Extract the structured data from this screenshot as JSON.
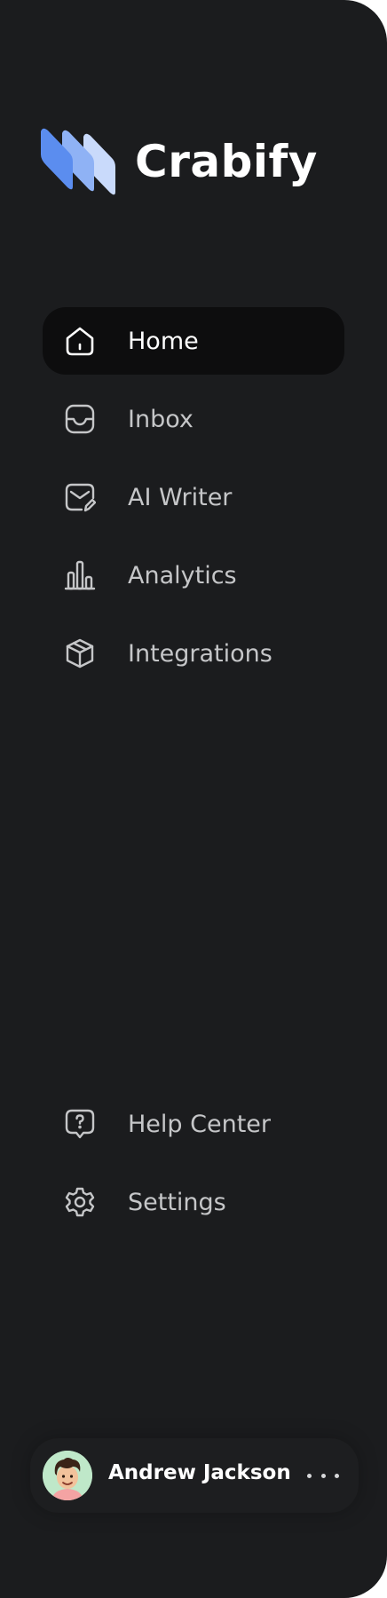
{
  "brand": {
    "name": "Crabify",
    "logo_icon": "crabify-stacked-bars-logo"
  },
  "nav": {
    "items": [
      {
        "label": "Home",
        "icon": "home-icon",
        "active": true
      },
      {
        "label": "Inbox",
        "icon": "inbox-icon",
        "active": false
      },
      {
        "label": "AI Writer",
        "icon": "mail-edit-icon",
        "active": false
      },
      {
        "label": "Analytics",
        "icon": "bar-chart-icon",
        "active": false
      },
      {
        "label": "Integrations",
        "icon": "cube-icon",
        "active": false
      }
    ],
    "bottom_items": [
      {
        "label": "Help Center",
        "icon": "help-bubble-icon"
      },
      {
        "label": "Settings",
        "icon": "gear-icon"
      }
    ]
  },
  "user": {
    "name": "Andrew Jackson",
    "menu_icon": "more-horizontal-icon"
  },
  "colors": {
    "sidebar_bg": "#1b1c1e",
    "active_bg": "#0d0d0e",
    "text_active": "#ffffff",
    "text_inactive": "#c5c6c8",
    "logo_blue": "#5b8def",
    "logo_light_blue": "#8fb2f5",
    "logo_pale_blue": "#c9dafb"
  }
}
